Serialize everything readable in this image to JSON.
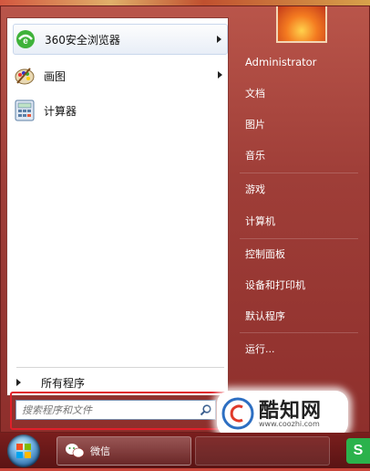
{
  "programs": [
    {
      "label": "360安全浏览器",
      "icon": "browser-360-icon",
      "has_submenu": true
    },
    {
      "label": "画图",
      "icon": "paint-palette-icon",
      "has_submenu": true
    },
    {
      "label": "计算器",
      "icon": "calculator-icon",
      "has_submenu": false
    }
  ],
  "all_programs_label": "所有程序",
  "search": {
    "placeholder": "搜索程序和文件"
  },
  "right_pane": {
    "user": "Administrator",
    "items": [
      "文档",
      "图片",
      "音乐",
      "游戏",
      "计算机",
      "控制面板",
      "设备和打印机",
      "默认程序",
      "运行..."
    ]
  },
  "taskbar": {
    "apps": [
      {
        "label": "微信",
        "icon": "wechat-icon"
      }
    ],
    "tray_glyph": "S"
  },
  "watermark": {
    "text": "酷知网",
    "url": "www.coozhi.com"
  },
  "colors": {
    "highlight_border": "#e0202a",
    "accent_green": "#2bb24c"
  }
}
